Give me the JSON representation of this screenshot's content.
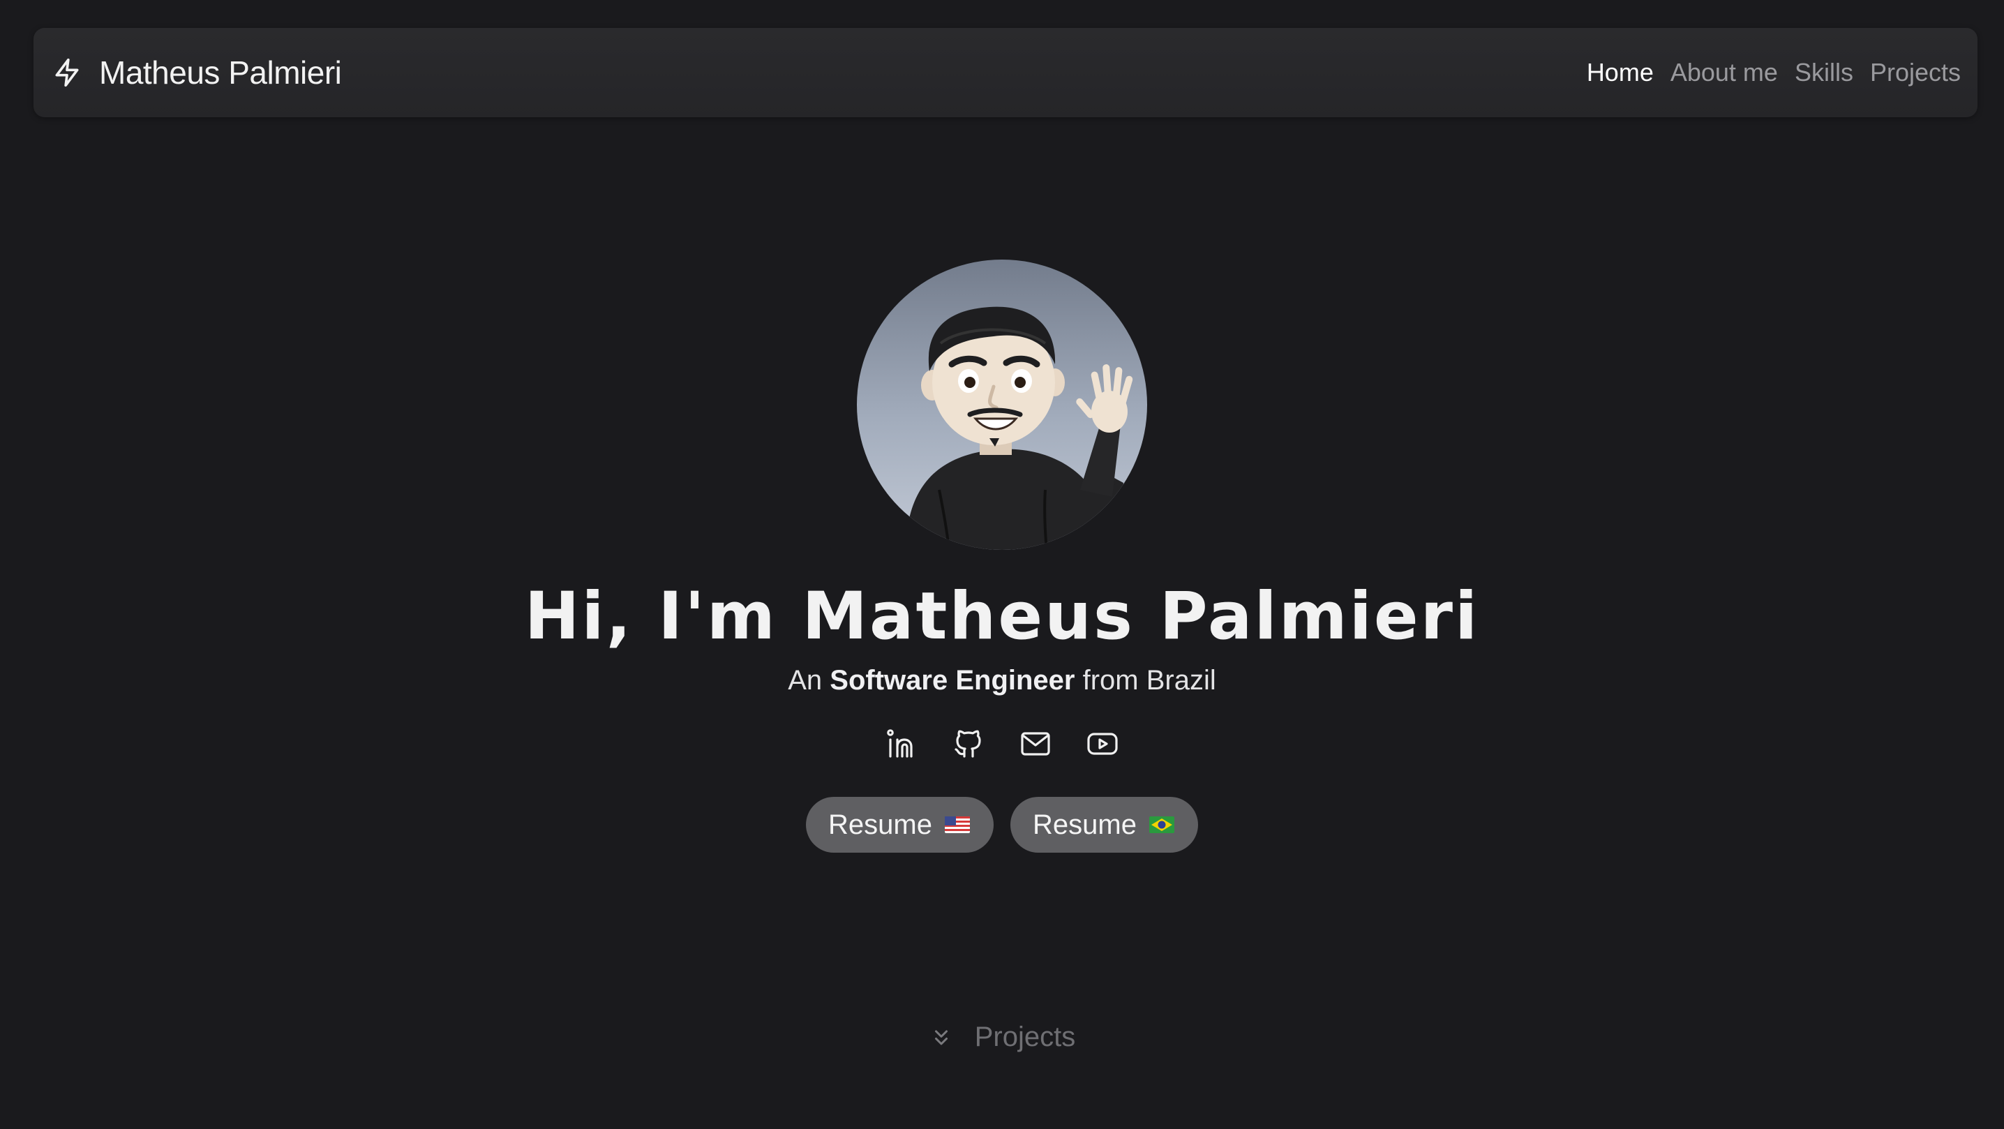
{
  "navbar": {
    "brand_name": "Matheus Palmieri",
    "brand_icon": "lightning-bolt-icon",
    "links": [
      {
        "label": "Home",
        "active": true
      },
      {
        "label": "About me",
        "active": false
      },
      {
        "label": "Skills",
        "active": false
      },
      {
        "label": "Projects",
        "active": false
      }
    ]
  },
  "hero": {
    "avatar_icon": "memoji-waving-avatar",
    "title": "Hi, I'm Matheus Palmieri",
    "subtitle_prefix": "An",
    "subtitle_role": "Software Engineer",
    "subtitle_suffix": "from Brazil",
    "social_links": [
      "linkedin-icon",
      "github-icon",
      "mail-icon",
      "youtube-icon"
    ],
    "buttons": [
      {
        "label": "Resume",
        "flag": "us-flag-icon"
      },
      {
        "label": "Resume",
        "flag": "brazil-flag-icon"
      }
    ]
  },
  "scroll_hint": {
    "label": "Projects",
    "icon": "chevrons-down-icon"
  },
  "colors": {
    "background": "#1a1a1d",
    "navbar": "#28282b",
    "text_primary": "#f2f2f2",
    "nav_inactive": "#9a9a9e",
    "button_bg": "#5f5f62",
    "muted": "#6f6f73"
  }
}
